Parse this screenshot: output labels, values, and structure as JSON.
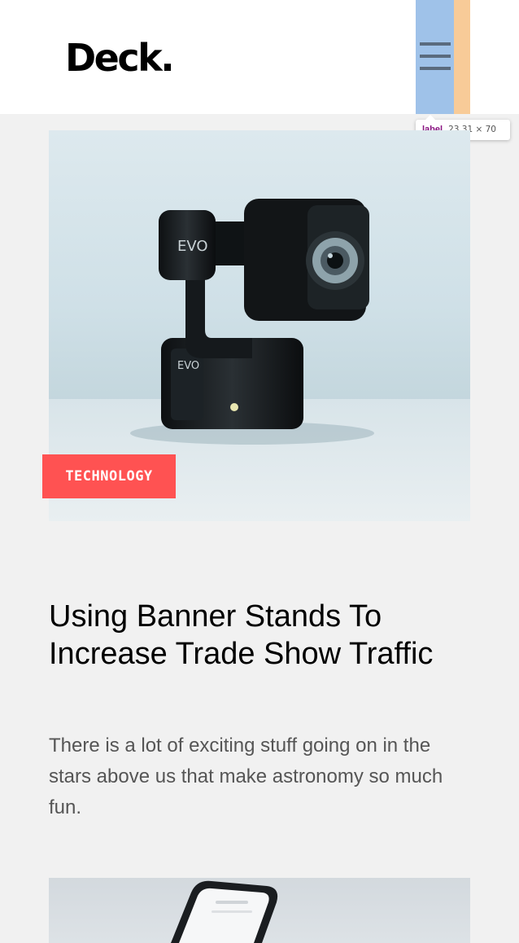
{
  "header": {
    "logo": "Deck.",
    "menu_icon": "hamburger-menu-icon"
  },
  "devtools_tooltip": {
    "tag": "label",
    "dimensions": "23.31 × 70"
  },
  "post": {
    "category": "TECHNOLOGY",
    "title": "Using Banner Stands To Increase Trade Show Traffic",
    "excerpt": "There is a lot of exciting stuff going on in the stars above us that make astronomy so much fun.",
    "image": "camera-gimbal-photo"
  },
  "next_post": {
    "image": "smartphone-photo"
  },
  "colors": {
    "background": "#f1f1f1",
    "header_bg": "#ffffff",
    "category_bg": "#ff5252",
    "highlight_content": "#9fc2e9",
    "highlight_padding": "#f8cb98",
    "excerpt_text": "#555555"
  }
}
